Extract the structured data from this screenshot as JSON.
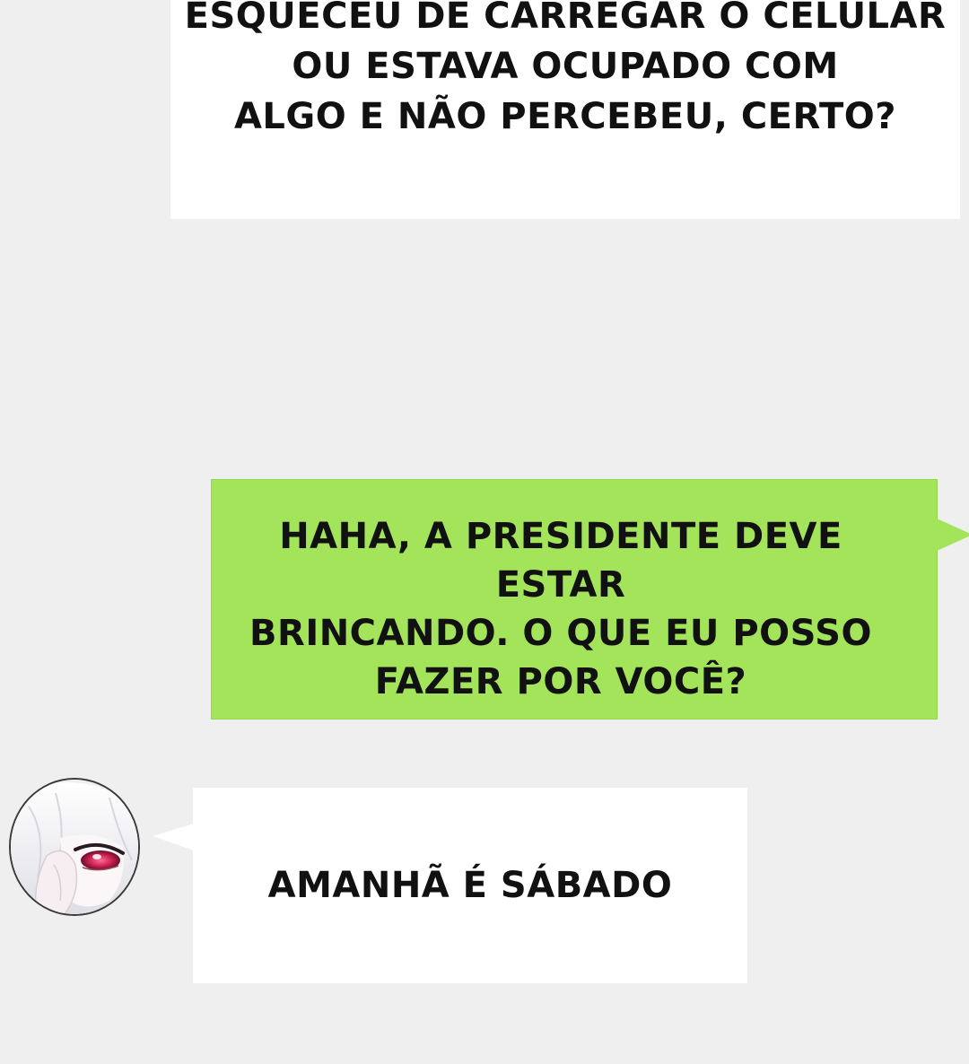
{
  "messages": [
    {
      "sender": "other",
      "text": "ESQUECEU DE CARREGAR O CELULAR\nOU ESTAVA OCUPADO COM\nALGO E NÃO PERCEBEU, CERTO?"
    },
    {
      "sender": "me",
      "text": "HAHA, A PRESIDENTE DEVE ESTAR\nBRINCANDO. O QUE EU POSSO\nFAZER POR VOCÊ?"
    },
    {
      "sender": "other",
      "text": "AMANHÃ É SÁBADO"
    }
  ],
  "colors": {
    "background": "#efefef",
    "outgoing_bubble": "#a3e45a",
    "incoming_bubble": "#ffffff",
    "text": "#111111"
  },
  "icons": {
    "avatar": "white-haired-girl-red-eye-avatar"
  }
}
